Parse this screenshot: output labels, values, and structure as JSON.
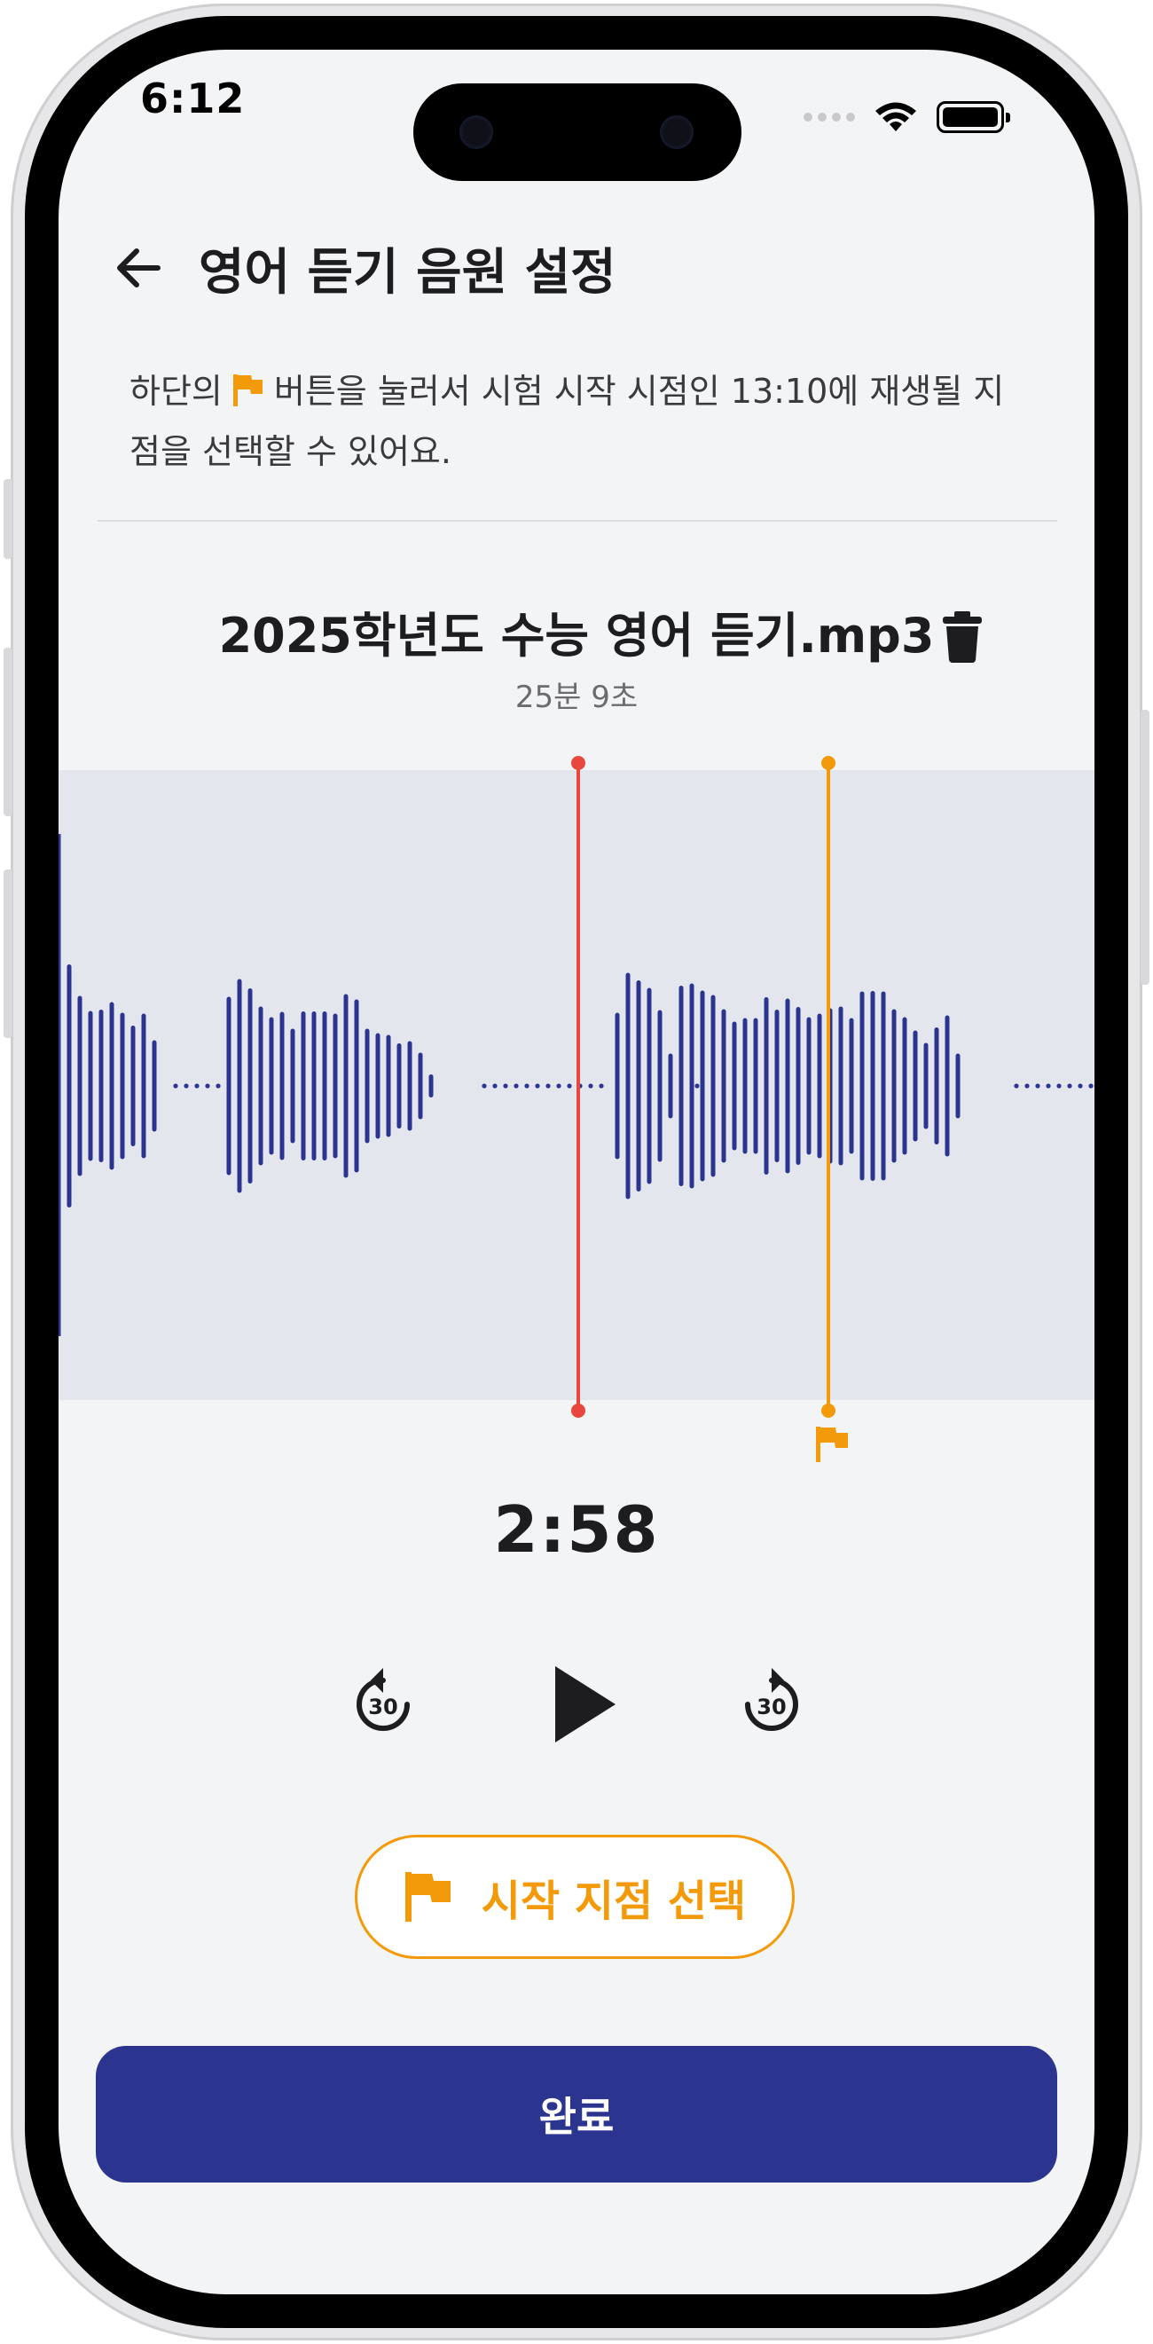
{
  "status": {
    "time": "6:12"
  },
  "header": {
    "title": "영어 듣기 음원 설정"
  },
  "info": {
    "text_before": "하단의",
    "text_after": "버튼을 눌러서 시험 시작 시점인 13:10에 재생될 지점을 선택할 수 있어요."
  },
  "file": {
    "name": "2025학년도 수능 영어 듣기.mp3",
    "duration": "25분 9초"
  },
  "player": {
    "current_time": "2:58",
    "rewind_seconds": "30",
    "forward_seconds": "30",
    "progress_fraction": 0.5
  },
  "buttons": {
    "start_point": "시작 지점 선택",
    "done": "완료"
  },
  "colors": {
    "accent": "#f39a0b",
    "primary": "#2b3590",
    "waveform": "#2b3590",
    "playhead": "#e8473e",
    "background": "#f3f4f6",
    "wave_bg": "#e4e6ee"
  },
  "icons": {
    "back": "arrow-left-icon",
    "flag": "flag-icon",
    "trash": "trash-icon",
    "rewind": "rewind-30-icon",
    "play": "play-icon",
    "forward": "forward-30-icon"
  }
}
